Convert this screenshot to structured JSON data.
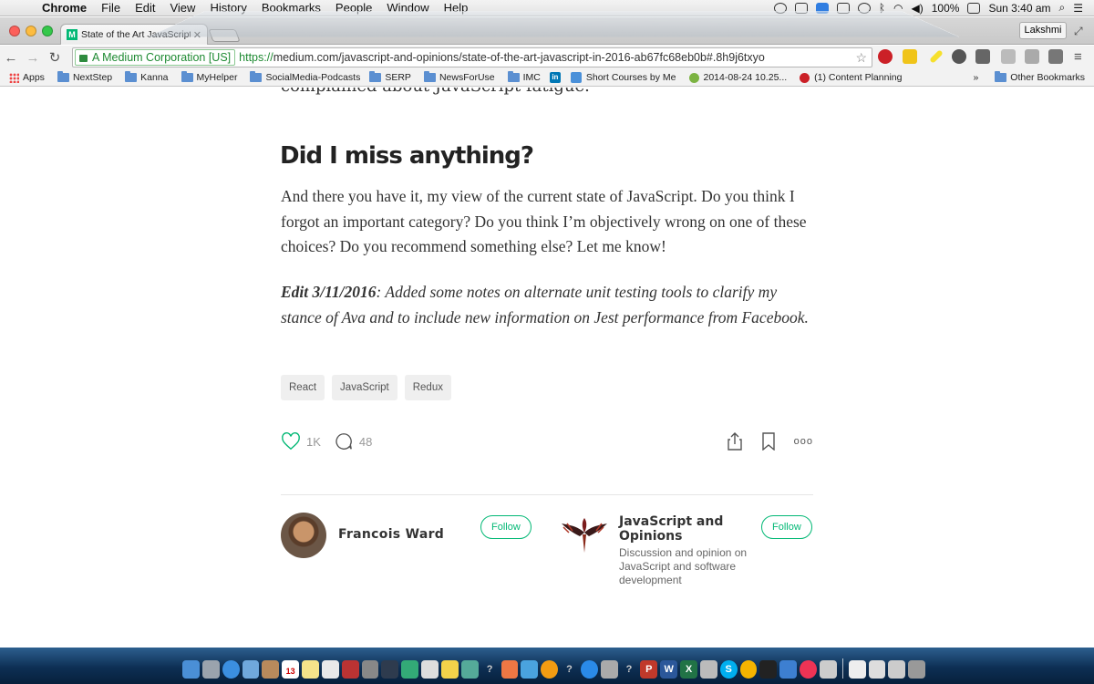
{
  "menubar": {
    "app_name": "Chrome",
    "menus": [
      "File",
      "Edit",
      "View",
      "History",
      "Bookmarks",
      "People",
      "Window",
      "Help"
    ],
    "battery": "100%",
    "clock": "Sun 3:40 am"
  },
  "browser": {
    "tab_title": "State of the Art JavaScript i",
    "tab_favicon": "M",
    "profile_name": "Lakshmi",
    "ev_label": "A Medium Corporation [US]",
    "url_scheme": "https://",
    "url_rest": "medium.com/javascript-and-opinions/state-of-the-art-javascript-in-2016-ab67fc68eb0b#.8h9j6txyo"
  },
  "bookmarks": {
    "apps": "Apps",
    "items": [
      "NextStep",
      "Kanna",
      "MyHelper",
      "SocialMedia-Podcasts",
      "SERP",
      "NewsForUse",
      "IMC"
    ],
    "linkedin_label": "in",
    "short_courses": "Short Courses by Me",
    "dated_item": "2014-08-24 10.25...",
    "content_planning": "(1) Content Planning",
    "overflow": "»",
    "other": "Other Bookmarks"
  },
  "article": {
    "cut_text": "complained about JavaScript fatigue.",
    "heading": "Did I miss anything?",
    "paragraph": "And there you have it, my view of the current state of JavaScript. Do you think I forgot an important category? Do you think I’m objectively wrong on one of these choices? Do you recommend something else? Let me know!",
    "edit_label": "Edit 3/11/2016",
    "edit_text": ": Added some notes on alternate unit testing tools to clarify my stance of Ava and to include new information on Jest performance from Facebook.",
    "tags": [
      "React",
      "JavaScript",
      "Redux"
    ],
    "recommends": "1K",
    "responses": "48",
    "more": "ooo"
  },
  "author": {
    "name": "Francois Ward",
    "follow_label": "Follow"
  },
  "publication": {
    "name": "JavaScript and Opinions",
    "description": "Discussion and opinion on JavaScript and software development",
    "follow_label": "Follow"
  },
  "dock": {
    "calendar_day": "13"
  },
  "colors": {
    "medium_green": "#02b875",
    "ev_green": "#1e8a32"
  }
}
